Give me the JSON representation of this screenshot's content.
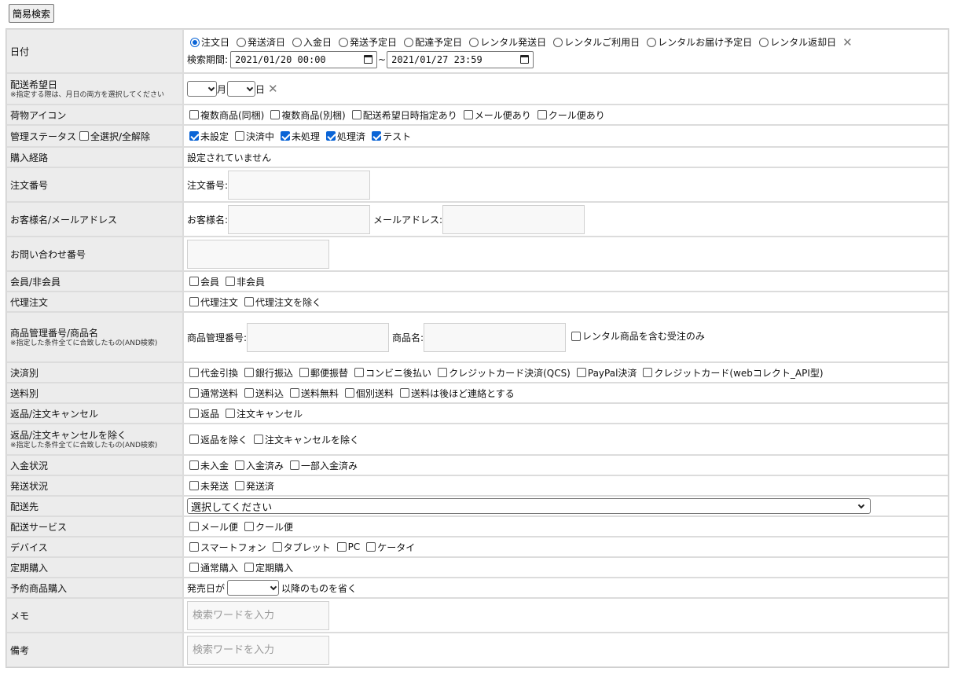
{
  "top_button": "簡易検索",
  "rows": {
    "date": {
      "label": "日付",
      "options": [
        "注文日",
        "発送済日",
        "入金日",
        "発送予定日",
        "配達予定日",
        "レンタル発送日",
        "レンタルご利用日",
        "レンタルお届け予定日",
        "レンタル返却日"
      ],
      "selected_index": 0,
      "period_label": "検索期間:",
      "from": "2021/01/20 00:00",
      "tilde": "~",
      "to": "2021/01/27 23:59"
    },
    "delivery_wish": {
      "label": "配送希望日",
      "note": "※指定する際は、月日の両方を選択してください",
      "month_label": "月",
      "day_label": "日"
    },
    "package_icon": {
      "label": "荷物アイコン",
      "options": [
        "複数商品(同梱)",
        "複数商品(別梱)",
        "配送希望日時指定あり",
        "メール便あり",
        "クール便あり"
      ]
    },
    "status": {
      "label": "管理ステータス",
      "select_all": "全選択/全解除",
      "options": [
        "未設定",
        "決済中",
        "未処理",
        "処理済",
        "テスト"
      ],
      "checked": [
        true,
        false,
        true,
        true,
        true
      ]
    },
    "route": {
      "label": "購入経路",
      "value": "設定されていません"
    },
    "order_no": {
      "label": "注文番号",
      "field_label": "注文番号:"
    },
    "customer": {
      "label": "お客様名/メールアドレス",
      "name_label": "お客様名:",
      "email_label": "メールアドレス:"
    },
    "inquiry": {
      "label": "お問い合わせ番号"
    },
    "member": {
      "label": "会員/非会員",
      "options": [
        "会員",
        "非会員"
      ]
    },
    "proxy": {
      "label": "代理注文",
      "options": [
        "代理注文",
        "代理注文を除く"
      ]
    },
    "product": {
      "label": "商品管理番号/商品名",
      "note": "※指定した条件全てに合致したもの(AND検索)",
      "code_label": "商品管理番号:",
      "name_label": "商品名:",
      "rental_only": "レンタル商品を含む受注のみ"
    },
    "payment": {
      "label": "決済別",
      "options": [
        "代金引換",
        "銀行振込",
        "郵便振替",
        "コンビニ後払い",
        "クレジットカード決済(QCS)",
        "PayPal決済",
        "クレジットカード(webコレクト_API型)"
      ]
    },
    "shipping_fee": {
      "label": "送料別",
      "options": [
        "通常送料",
        "送料込",
        "送料無料",
        "個別送料",
        "送料は後ほど連絡とする"
      ]
    },
    "return_cancel": {
      "label": "返品/注文キャンセル",
      "options": [
        "返品",
        "注文キャンセル"
      ]
    },
    "exclude_return": {
      "label": "返品/注文キャンセルを除く",
      "note": "※指定した条件全てに合致したもの(AND検索)",
      "options": [
        "返品を除く",
        "注文キャンセルを除く"
      ]
    },
    "payment_status": {
      "label": "入金状況",
      "options": [
        "未入金",
        "入金済み",
        "一部入金済み"
      ]
    },
    "ship_status": {
      "label": "発送状況",
      "options": [
        "未発送",
        "発送済"
      ]
    },
    "destination": {
      "label": "配送先",
      "placeholder": "選択してください"
    },
    "ship_service": {
      "label": "配送サービス",
      "options": [
        "メール便",
        "クール便"
      ]
    },
    "device": {
      "label": "デバイス",
      "options": [
        "スマートフォン",
        "タブレット",
        "PC",
        "ケータイ"
      ]
    },
    "subscription": {
      "label": "定期購入",
      "options": [
        "通常購入",
        "定期購入"
      ]
    },
    "preorder": {
      "label": "予約商品購入",
      "prefix": "発売日が",
      "suffix": "以降のものを省く"
    },
    "memo": {
      "label": "メモ",
      "placeholder": "検索ワードを入力"
    },
    "remarks": {
      "label": "備考",
      "placeholder": "検索ワードを入力"
    }
  }
}
